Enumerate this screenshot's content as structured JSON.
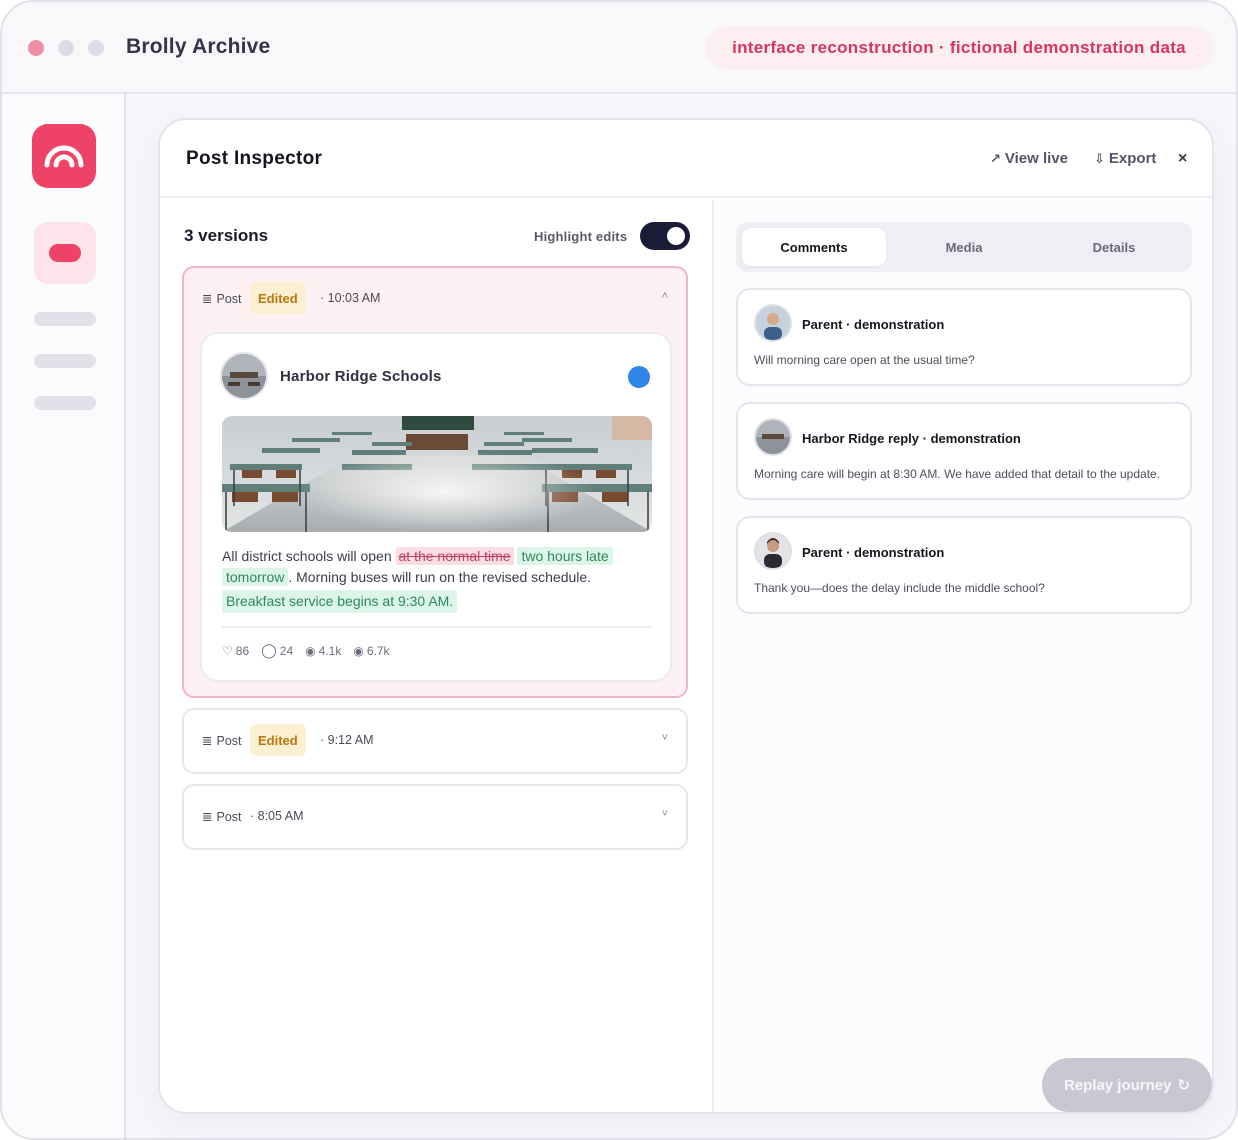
{
  "app": {
    "title": "Brolly Archive",
    "demo_note": "interface reconstruction · fictional demonstration data"
  },
  "colors": {
    "accent": "#ef4267",
    "verified": "#2f86e8",
    "edited_badge": "#fdf0d2",
    "deleted": "#fbdde4",
    "inserted": "#dcf5e8"
  },
  "sidebar": {
    "logo_icon": "umbrella-arc-icon",
    "items": [
      "active-nav-item",
      "nav-placeholder",
      "nav-placeholder",
      "nav-placeholder"
    ]
  },
  "inspector": {
    "title": "Post Inspector",
    "view_live": {
      "icon": "↗",
      "label": "View live"
    },
    "export": {
      "icon": "⇩",
      "label": "Export"
    },
    "close_icon": "×"
  },
  "versions": {
    "title": "3 versions",
    "highlight_label": "Highlight edits",
    "highlight_on": true,
    "items": [
      {
        "type": "Post",
        "badge": "Edited",
        "time": "· 10:03 AM",
        "expanded": true,
        "chevron": "˄"
      },
      {
        "type": "Post",
        "badge": "Edited",
        "time": "· 9:12 AM",
        "expanded": false,
        "chevron": "˅"
      },
      {
        "type": "Post",
        "badge": "",
        "time": "· 8:05 AM",
        "expanded": false,
        "chevron": "˅"
      }
    ]
  },
  "post": {
    "author": "Harbor Ridge Schools",
    "text_before": "All district schools will open",
    "deleted": "at the normal time",
    "inserted_1a": "two hours late",
    "inserted_1b": "tomorrow",
    "text_after": ". Morning buses will run on the revised schedule.",
    "inserted_2": "Breakfast service begins at 9:30 AM.",
    "stats": {
      "likes": "86",
      "comments": "24",
      "views": "4.1k",
      "reach": "6.7k"
    }
  },
  "tabs": [
    "Comments",
    "Media",
    "Details"
  ],
  "active_tab": "Comments",
  "comments": [
    {
      "name": "Parent · demonstration",
      "text": "Will morning care open at the usual time?"
    },
    {
      "name": "Harbor Ridge reply · demonstration",
      "text": "Morning care will begin at 8:30 AM. We have added that detail to the update."
    },
    {
      "name": "Parent · demonstration",
      "text": "Thank you—does the delay include the middle school?"
    }
  ],
  "replay": {
    "label": "Replay journey",
    "icon": "↻"
  }
}
